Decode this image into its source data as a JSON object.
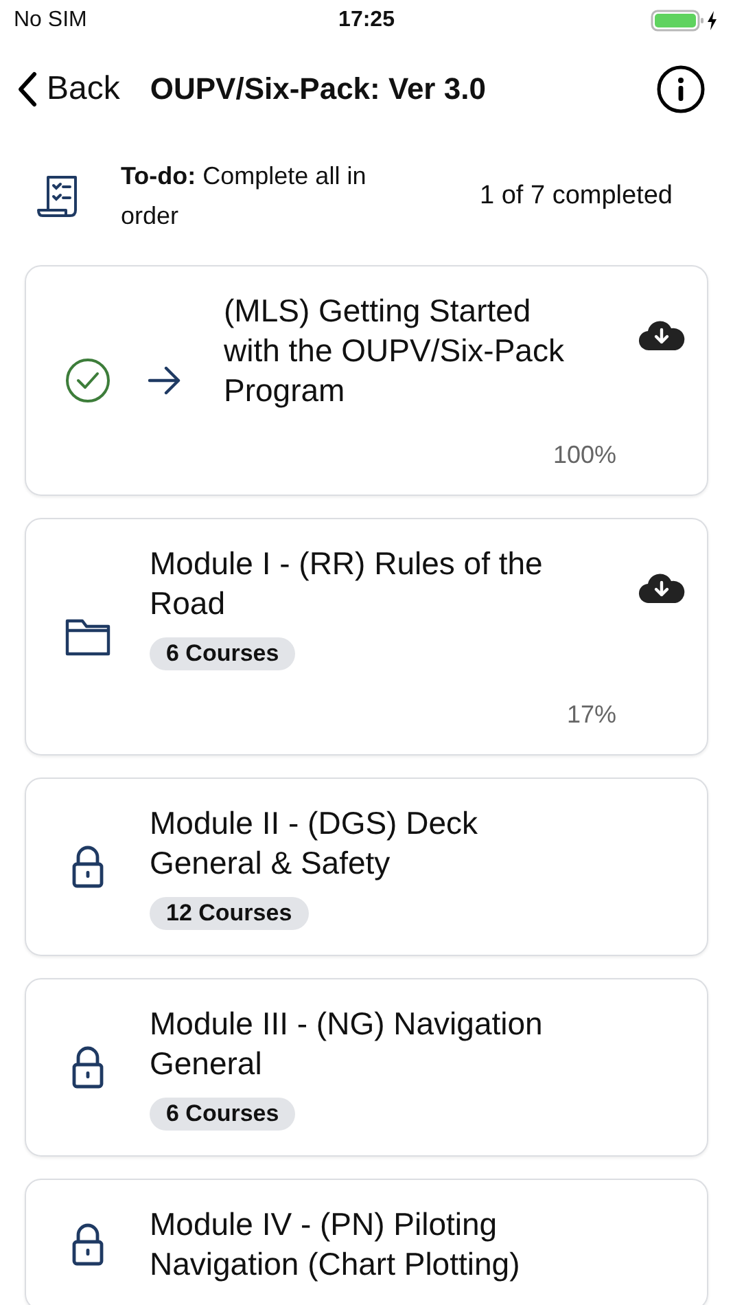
{
  "status_bar": {
    "carrier": "No SIM",
    "time": "17:25"
  },
  "nav": {
    "back": "Back",
    "title": "OUPV/Six-Pack: Ver 3.0"
  },
  "todo": {
    "text": "**To-do:** Complete all in order",
    "progress": "1 of 7 completed"
  },
  "items": [
    {
      "kind": "lesson",
      "completed": true,
      "title": "(MLS) Getting Started with the OUPV/Six-Pack Program",
      "downloadable": true,
      "percent": "100%"
    },
    {
      "kind": "module",
      "title": "Module I - (RR) Rules of the Road",
      "courses": "6 Courses",
      "downloadable": true,
      "percent": "17%"
    },
    {
      "kind": "locked",
      "title": "Module II - (DGS) Deck General & Safety",
      "courses": "12 Courses",
      "downloadable": false
    },
    {
      "kind": "locked",
      "title": "Module III - (NG) Navigation General",
      "courses": "6 Courses",
      "downloadable": false
    },
    {
      "kind": "locked",
      "title": "Module IV - (PN) Piloting Navigation (Chart Plotting)",
      "downloadable": false
    }
  ]
}
